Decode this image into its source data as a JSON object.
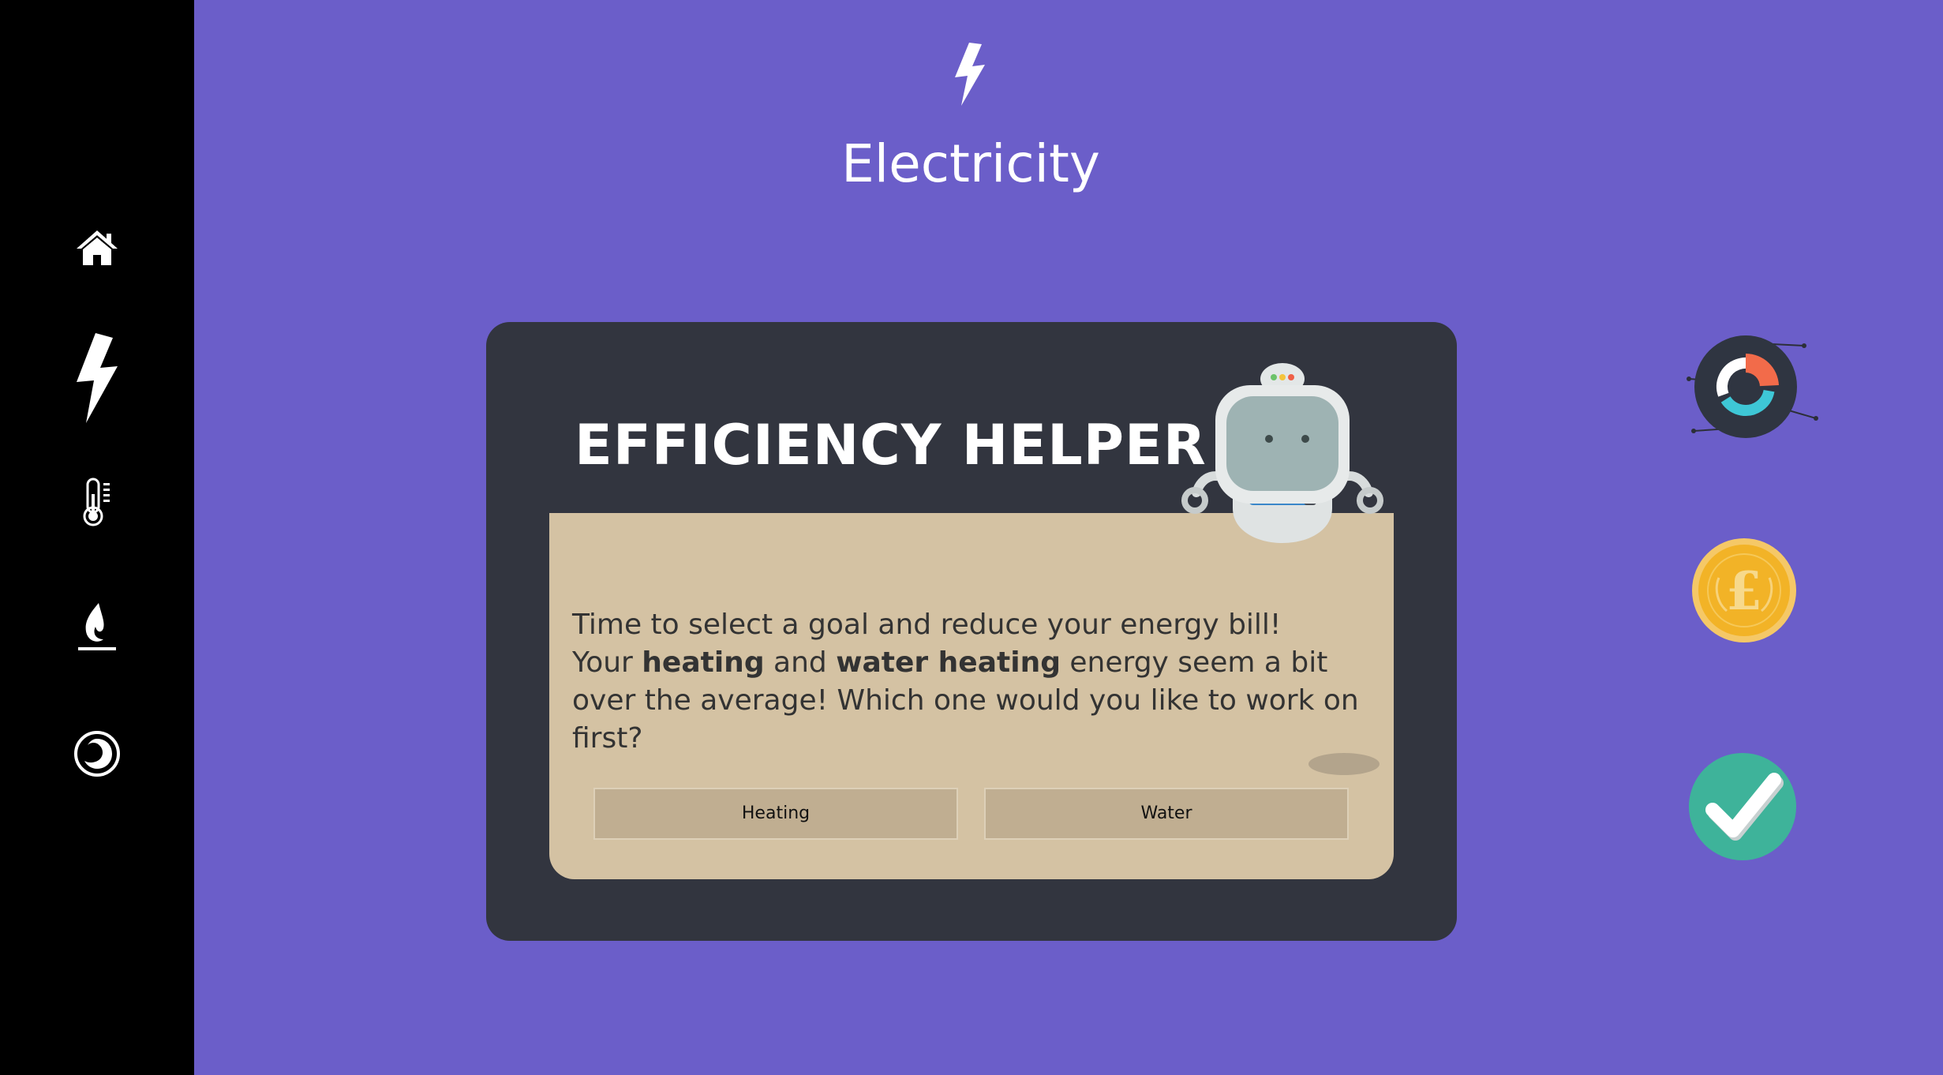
{
  "header": {
    "icon": "lightning-bolt-icon",
    "title": "Electricity"
  },
  "sidebar": {
    "items": [
      {
        "icon": "home-icon"
      },
      {
        "icon": "lightning-bolt-icon",
        "active": true
      },
      {
        "icon": "thermometer-icon"
      },
      {
        "icon": "flame-icon"
      },
      {
        "icon": "water-drop-icon"
      }
    ]
  },
  "helper": {
    "title": "EFFICIENCY HELPER",
    "mascot": "robot-icon",
    "message": {
      "line1": "Time to select a goal and reduce your energy bill!",
      "line2_prefix": "Your ",
      "line2_bold1": "heating",
      "line2_mid": " and ",
      "line2_bold2": "water heating",
      "line2_suffix": " energy seem a bit over the average! Which one would you like to work on first?"
    },
    "choices": {
      "heating": "Heating",
      "water": "Water"
    }
  },
  "right_icons": [
    {
      "icon": "donut-chart-icon"
    },
    {
      "icon": "pound-coin-icon"
    },
    {
      "icon": "checkmark-icon"
    }
  ],
  "colors": {
    "background": "#6b5ec9",
    "sidebar": "#000000",
    "panel": "#32353f",
    "card": "#d4c2a3",
    "button": "#c0ae91",
    "accent_orange": "#f26b4a",
    "accent_teal": "#3ec7d6",
    "coin": "#f2b327",
    "check": "#3eb39a"
  }
}
